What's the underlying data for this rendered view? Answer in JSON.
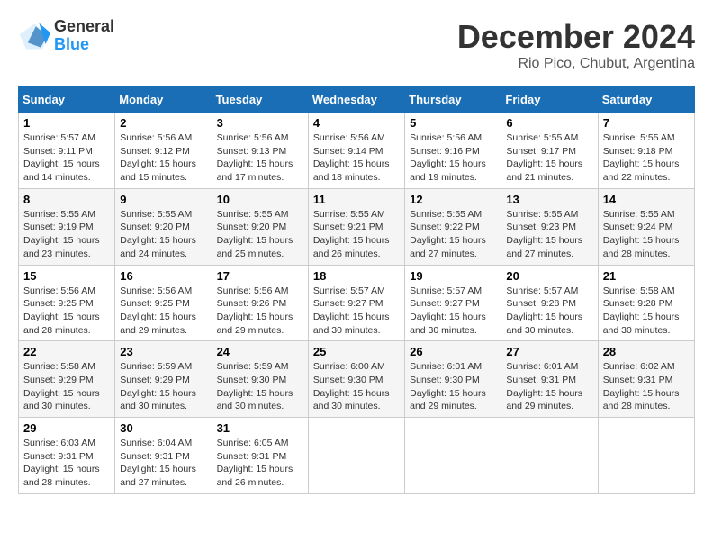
{
  "header": {
    "logo_general": "General",
    "logo_blue": "Blue",
    "month_title": "December 2024",
    "location": "Rio Pico, Chubut, Argentina"
  },
  "calendar": {
    "days_of_week": [
      "Sunday",
      "Monday",
      "Tuesday",
      "Wednesday",
      "Thursday",
      "Friday",
      "Saturday"
    ],
    "weeks": [
      [
        null,
        {
          "day": "2",
          "sunrise": "Sunrise: 5:56 AM",
          "sunset": "Sunset: 9:12 PM",
          "daylight": "Daylight: 15 hours and 15 minutes."
        },
        {
          "day": "3",
          "sunrise": "Sunrise: 5:56 AM",
          "sunset": "Sunset: 9:13 PM",
          "daylight": "Daylight: 15 hours and 17 minutes."
        },
        {
          "day": "4",
          "sunrise": "Sunrise: 5:56 AM",
          "sunset": "Sunset: 9:14 PM",
          "daylight": "Daylight: 15 hours and 18 minutes."
        },
        {
          "day": "5",
          "sunrise": "Sunrise: 5:56 AM",
          "sunset": "Sunset: 9:16 PM",
          "daylight": "Daylight: 15 hours and 19 minutes."
        },
        {
          "day": "6",
          "sunrise": "Sunrise: 5:55 AM",
          "sunset": "Sunset: 9:17 PM",
          "daylight": "Daylight: 15 hours and 21 minutes."
        },
        {
          "day": "7",
          "sunrise": "Sunrise: 5:55 AM",
          "sunset": "Sunset: 9:18 PM",
          "daylight": "Daylight: 15 hours and 22 minutes."
        }
      ],
      [
        {
          "day": "8",
          "sunrise": "Sunrise: 5:55 AM",
          "sunset": "Sunset: 9:19 PM",
          "daylight": "Daylight: 15 hours and 23 minutes."
        },
        {
          "day": "9",
          "sunrise": "Sunrise: 5:55 AM",
          "sunset": "Sunset: 9:20 PM",
          "daylight": "Daylight: 15 hours and 24 minutes."
        },
        {
          "day": "10",
          "sunrise": "Sunrise: 5:55 AM",
          "sunset": "Sunset: 9:20 PM",
          "daylight": "Daylight: 15 hours and 25 minutes."
        },
        {
          "day": "11",
          "sunrise": "Sunrise: 5:55 AM",
          "sunset": "Sunset: 9:21 PM",
          "daylight": "Daylight: 15 hours and 26 minutes."
        },
        {
          "day": "12",
          "sunrise": "Sunrise: 5:55 AM",
          "sunset": "Sunset: 9:22 PM",
          "daylight": "Daylight: 15 hours and 27 minutes."
        },
        {
          "day": "13",
          "sunrise": "Sunrise: 5:55 AM",
          "sunset": "Sunset: 9:23 PM",
          "daylight": "Daylight: 15 hours and 27 minutes."
        },
        {
          "day": "14",
          "sunrise": "Sunrise: 5:55 AM",
          "sunset": "Sunset: 9:24 PM",
          "daylight": "Daylight: 15 hours and 28 minutes."
        }
      ],
      [
        {
          "day": "15",
          "sunrise": "Sunrise: 5:56 AM",
          "sunset": "Sunset: 9:25 PM",
          "daylight": "Daylight: 15 hours and 28 minutes."
        },
        {
          "day": "16",
          "sunrise": "Sunrise: 5:56 AM",
          "sunset": "Sunset: 9:25 PM",
          "daylight": "Daylight: 15 hours and 29 minutes."
        },
        {
          "day": "17",
          "sunrise": "Sunrise: 5:56 AM",
          "sunset": "Sunset: 9:26 PM",
          "daylight": "Daylight: 15 hours and 29 minutes."
        },
        {
          "day": "18",
          "sunrise": "Sunrise: 5:57 AM",
          "sunset": "Sunset: 9:27 PM",
          "daylight": "Daylight: 15 hours and 30 minutes."
        },
        {
          "day": "19",
          "sunrise": "Sunrise: 5:57 AM",
          "sunset": "Sunset: 9:27 PM",
          "daylight": "Daylight: 15 hours and 30 minutes."
        },
        {
          "day": "20",
          "sunrise": "Sunrise: 5:57 AM",
          "sunset": "Sunset: 9:28 PM",
          "daylight": "Daylight: 15 hours and 30 minutes."
        },
        {
          "day": "21",
          "sunrise": "Sunrise: 5:58 AM",
          "sunset": "Sunset: 9:28 PM",
          "daylight": "Daylight: 15 hours and 30 minutes."
        }
      ],
      [
        {
          "day": "22",
          "sunrise": "Sunrise: 5:58 AM",
          "sunset": "Sunset: 9:29 PM",
          "daylight": "Daylight: 15 hours and 30 minutes."
        },
        {
          "day": "23",
          "sunrise": "Sunrise: 5:59 AM",
          "sunset": "Sunset: 9:29 PM",
          "daylight": "Daylight: 15 hours and 30 minutes."
        },
        {
          "day": "24",
          "sunrise": "Sunrise: 5:59 AM",
          "sunset": "Sunset: 9:30 PM",
          "daylight": "Daylight: 15 hours and 30 minutes."
        },
        {
          "day": "25",
          "sunrise": "Sunrise: 6:00 AM",
          "sunset": "Sunset: 9:30 PM",
          "daylight": "Daylight: 15 hours and 30 minutes."
        },
        {
          "day": "26",
          "sunrise": "Sunrise: 6:01 AM",
          "sunset": "Sunset: 9:30 PM",
          "daylight": "Daylight: 15 hours and 29 minutes."
        },
        {
          "day": "27",
          "sunrise": "Sunrise: 6:01 AM",
          "sunset": "Sunset: 9:31 PM",
          "daylight": "Daylight: 15 hours and 29 minutes."
        },
        {
          "day": "28",
          "sunrise": "Sunrise: 6:02 AM",
          "sunset": "Sunset: 9:31 PM",
          "daylight": "Daylight: 15 hours and 28 minutes."
        }
      ],
      [
        {
          "day": "29",
          "sunrise": "Sunrise: 6:03 AM",
          "sunset": "Sunset: 9:31 PM",
          "daylight": "Daylight: 15 hours and 28 minutes."
        },
        {
          "day": "30",
          "sunrise": "Sunrise: 6:04 AM",
          "sunset": "Sunset: 9:31 PM",
          "daylight": "Daylight: 15 hours and 27 minutes."
        },
        {
          "day": "31",
          "sunrise": "Sunrise: 6:05 AM",
          "sunset": "Sunset: 9:31 PM",
          "daylight": "Daylight: 15 hours and 26 minutes."
        },
        null,
        null,
        null,
        null
      ]
    ],
    "week1_sunday": {
      "day": "1",
      "sunrise": "Sunrise: 5:57 AM",
      "sunset": "Sunset: 9:11 PM",
      "daylight": "Daylight: 15 hours and 14 minutes."
    }
  }
}
